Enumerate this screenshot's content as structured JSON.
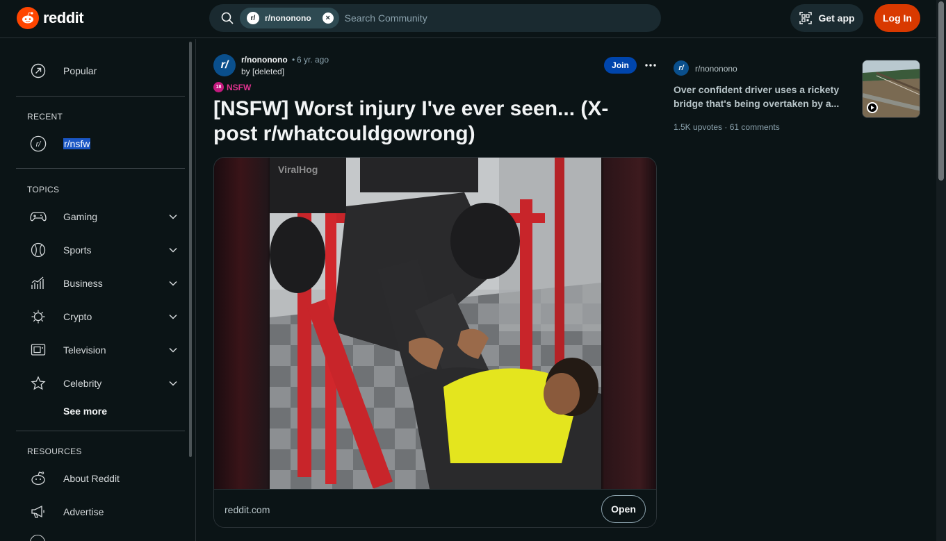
{
  "header": {
    "logo_text": "reddit",
    "search": {
      "chip_avatar": "r/",
      "chip_label": "r/nononono",
      "chip_clear": "×",
      "placeholder": "Search Community"
    },
    "get_app_label": "Get app",
    "login_label": "Log In"
  },
  "sidebar": {
    "popular_label": "Popular",
    "recent_heading": "RECENT",
    "recent_items": [
      {
        "label": "r/nsfw",
        "avatar": "r/"
      }
    ],
    "topics_heading": "TOPICS",
    "topics": [
      {
        "label": "Gaming",
        "icon": "gamepad-icon"
      },
      {
        "label": "Sports",
        "icon": "ball-icon"
      },
      {
        "label": "Business",
        "icon": "chart-icon"
      },
      {
        "label": "Crypto",
        "icon": "crypto-icon"
      },
      {
        "label": "Television",
        "icon": "tv-icon"
      },
      {
        "label": "Celebrity",
        "icon": "star-icon"
      }
    ],
    "see_more_label": "See more",
    "resources_heading": "RESOURCES",
    "resources": [
      {
        "label": "About Reddit",
        "icon": "reddit-alien-icon"
      },
      {
        "label": "Advertise",
        "icon": "megaphone-icon"
      }
    ]
  },
  "post": {
    "avatar": "r/",
    "subreddit": "r/nononono",
    "separator": "•",
    "time": "6 yr. ago",
    "author": "by [deleted]",
    "join_label": "Join",
    "more_label": "•••",
    "nsfw_badge": "18",
    "nsfw_label": "NSFW",
    "title": "[NSFW] Worst injury I've ever seen... (X-post r/whatcouldgowrong)",
    "watermark": "ViralHog",
    "media_domain": "reddit.com",
    "open_label": "Open"
  },
  "rail": {
    "avatar": "r/",
    "subreddit": "r/nononono",
    "title": "Over confident driver uses a rickety bridge that's being overtaken by a...",
    "meta": "1.5K upvotes · 61 comments"
  },
  "colors": {
    "background": "#0b1416",
    "brand_orange": "#ff4500",
    "login_button": "#d93900",
    "join_button": "#0045ac",
    "nsfw_pink": "#e0328f",
    "selection_highlight": "#1a56c4"
  }
}
